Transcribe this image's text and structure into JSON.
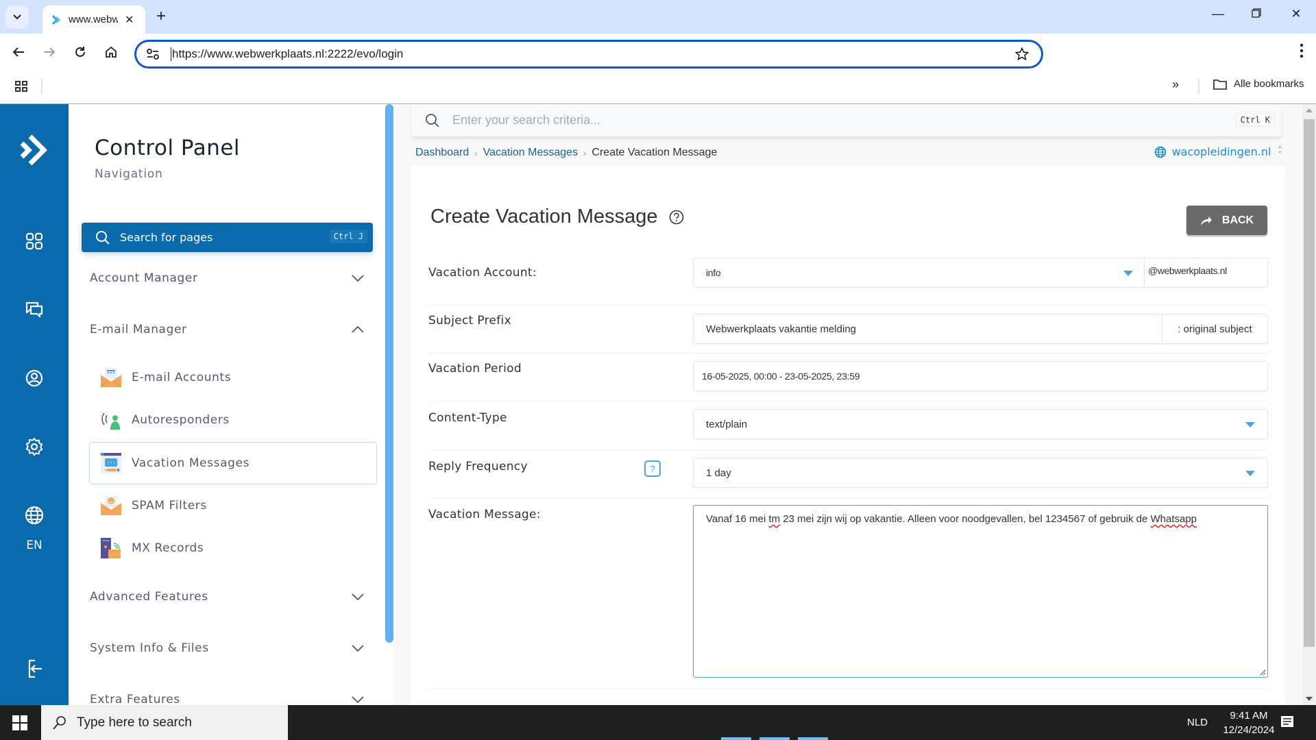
{
  "browser": {
    "tab_title": "www.webw",
    "url": "https://www.webwerkplaats.nl:2222/evo/login",
    "bookmarks_all_label": "Alle bookmarks"
  },
  "rail": {
    "icons": [
      "logo-icon",
      "dashboard-grid-icon",
      "chat-icon",
      "user-icon",
      "settings-icon",
      "globe-icon",
      "logout-icon"
    ],
    "language": "EN"
  },
  "nav": {
    "title": "Control Panel",
    "subtitle": "Navigation",
    "search_label": "Search for pages",
    "search_shortcut": "Ctrl J",
    "sections": {
      "account_manager": "Account Manager",
      "email_manager": "E-mail Manager",
      "advanced_features": "Advanced Features",
      "system_info": "System Info & Files",
      "extra_features": "Extra Features"
    },
    "email_items": [
      {
        "label": "E-mail Accounts"
      },
      {
        "label": "Autoresponders"
      },
      {
        "label": "Vacation Messages",
        "active": true
      },
      {
        "label": "SPAM Filters"
      },
      {
        "label": "MX Records"
      }
    ]
  },
  "top": {
    "search_placeholder": "Enter your search criteria...",
    "search_shortcut": "Ctrl K",
    "breadcrumbs": [
      "Dashboard",
      "Vacation Messages",
      "Create Vacation Message"
    ],
    "domain": "wacopleidingen.nl"
  },
  "form": {
    "title": "Create Vacation Message",
    "back_label": "BACK",
    "account": {
      "label": "Vacation Account:",
      "value": "info",
      "suffix": "@webwerkplaats.nl"
    },
    "subject": {
      "label": "Subject Prefix",
      "value": "Webwerkplaats vakantie melding",
      "suffix": ": original subject"
    },
    "period": {
      "label": "Vacation Period",
      "value": "16-05-2025, 00:00 - 23-05-2025, 23:59"
    },
    "content_type": {
      "label": "Content-Type",
      "value": "text/plain"
    },
    "reply_frequency": {
      "label": "Reply Frequency",
      "value": "1 day",
      "help": "?"
    },
    "message": {
      "label": "Vacation Message:",
      "part1": "Vanaf 16 mei ",
      "typo1": "tm",
      "part2": " 23 mei zijn wij op vakantie. Alleen voor noodgevallen, bel 1234567 of gebruik de ",
      "typo2": "Whatsapp"
    }
  },
  "taskbar": {
    "search_placeholder": "Type here to search",
    "language": "NLD",
    "time": "9:41 AM",
    "date": "12/24/2024"
  },
  "colors": {
    "brand_blue": "#0b6aab",
    "link_blue": "#1f8bcf",
    "accent_caret": "#4aa3df",
    "back_button": "#6a6a6a"
  }
}
